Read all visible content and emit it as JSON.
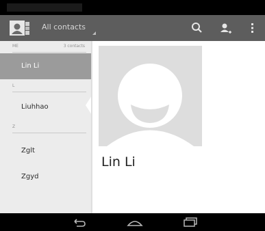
{
  "status_bar": {},
  "action_bar": {
    "title": "All contacts",
    "icons": [
      "contacts-app-icon",
      "search-icon",
      "add-person-icon",
      "overflow-menu-icon"
    ]
  },
  "contact_list": {
    "me_section": {
      "label": "ME",
      "count": "3 contacts"
    },
    "selected_contact": "Lin Li",
    "sections": [
      {
        "letter": "L",
        "contacts": [
          "Liuhhao"
        ]
      },
      {
        "letter": "Z",
        "contacts": [
          "Zglt",
          "Zgyd"
        ]
      }
    ]
  },
  "contact_detail": {
    "name": "Lin Li"
  },
  "nav_bar": {
    "buttons": [
      "back-icon",
      "home-icon",
      "recents-icon"
    ]
  },
  "colors": {
    "action_bar": "#5d5d5d",
    "list_background": "#ececec",
    "selected_item": "#9b9b9b",
    "photo_background": "#dddddd",
    "avatar": "#ffffff"
  }
}
